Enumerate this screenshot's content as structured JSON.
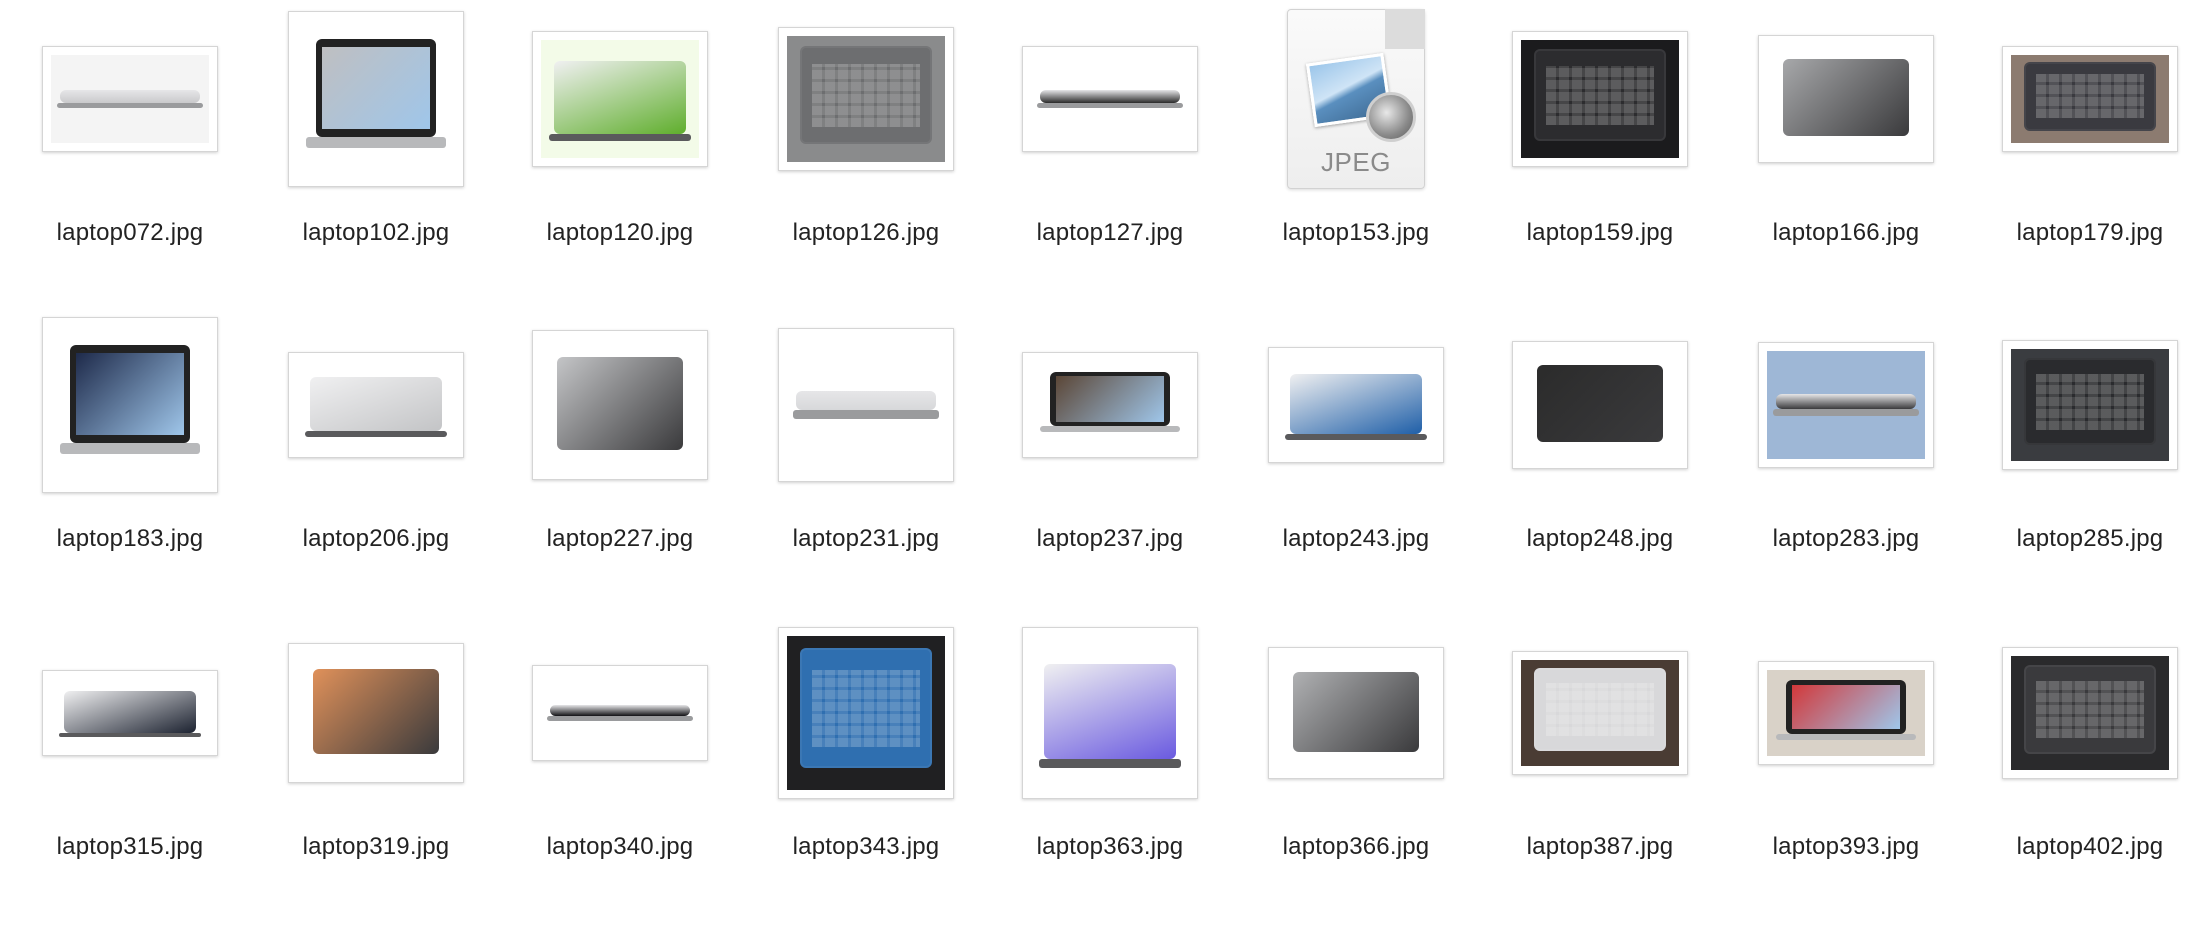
{
  "files": [
    {
      "name": "laptop072.jpg",
      "icon": "photo-thumbnail",
      "bg": "#f4f4f4",
      "accent": "#c9c9cb"
    },
    {
      "name": "laptop102.jpg",
      "icon": "photo-thumbnail",
      "bg": "#ffffff",
      "accent": "#bfbfc1"
    },
    {
      "name": "laptop120.jpg",
      "icon": "photo-thumbnail",
      "bg": "#f3fbe8",
      "accent": "#5fae2c"
    },
    {
      "name": "laptop126.jpg",
      "icon": "photo-thumbnail",
      "bg": "#8a8b8c",
      "accent": "#6d6e70"
    },
    {
      "name": "laptop127.jpg",
      "icon": "photo-thumbnail",
      "bg": "#ffffff",
      "accent": "#2a2a2a"
    },
    {
      "name": "laptop153.jpg",
      "icon": "jpeg-document-icon",
      "label": "JPEG"
    },
    {
      "name": "laptop159.jpg",
      "icon": "photo-thumbnail",
      "bg": "#1b1b1d",
      "accent": "#2c2c2f"
    },
    {
      "name": "laptop166.jpg",
      "icon": "photo-thumbnail",
      "bg": "#ffffff",
      "accent": "#a7a8aa"
    },
    {
      "name": "laptop179.jpg",
      "icon": "photo-thumbnail",
      "bg": "#8c7b70",
      "accent": "#3a3a40"
    },
    {
      "name": "laptop183.jpg",
      "icon": "photo-thumbnail",
      "bg": "#ffffff",
      "accent": "#1e2a4a"
    },
    {
      "name": "laptop206.jpg",
      "icon": "photo-thumbnail",
      "bg": "#ffffff",
      "accent": "#c3c4c6"
    },
    {
      "name": "laptop227.jpg",
      "icon": "photo-thumbnail",
      "bg": "#ffffff",
      "accent": "#c4c5c7"
    },
    {
      "name": "laptop231.jpg",
      "icon": "photo-thumbnail",
      "bg": "#ffffff",
      "accent": "#d7d8da"
    },
    {
      "name": "laptop237.jpg",
      "icon": "photo-thumbnail",
      "bg": "#ffffff",
      "accent": "#5b4636"
    },
    {
      "name": "laptop243.jpg",
      "icon": "photo-thumbnail",
      "bg": "#ffffff",
      "accent": "#1f5fa8"
    },
    {
      "name": "laptop248.jpg",
      "icon": "photo-thumbnail",
      "bg": "#ffffff",
      "accent": "#2b2b2b"
    },
    {
      "name": "laptop283.jpg",
      "icon": "photo-thumbnail",
      "bg": "#9eb7d6",
      "accent": "#3a3a3c"
    },
    {
      "name": "laptop285.jpg",
      "icon": "photo-thumbnail",
      "bg": "#3a3c40",
      "accent": "#2a2b2e"
    },
    {
      "name": "laptop315.jpg",
      "icon": "photo-thumbnail",
      "bg": "#ffffff",
      "accent": "#1c2230"
    },
    {
      "name": "laptop319.jpg",
      "icon": "photo-thumbnail",
      "bg": "#ffffff",
      "accent": "#e0915a"
    },
    {
      "name": "laptop340.jpg",
      "icon": "photo-thumbnail",
      "bg": "#ffffff",
      "accent": "#111114"
    },
    {
      "name": "laptop343.jpg",
      "icon": "photo-thumbnail",
      "bg": "#202022",
      "accent": "#2f6fb0"
    },
    {
      "name": "laptop363.jpg",
      "icon": "photo-thumbnail",
      "bg": "#ffffff",
      "accent": "#6a5ae0"
    },
    {
      "name": "laptop366.jpg",
      "icon": "photo-thumbnail",
      "bg": "#ffffff",
      "accent": "#b0b1b3"
    },
    {
      "name": "laptop387.jpg",
      "icon": "photo-thumbnail",
      "bg": "#4a3c34",
      "accent": "#d8d8da"
    },
    {
      "name": "laptop393.jpg",
      "icon": "photo-thumbnail",
      "bg": "#d9d2c8",
      "accent": "#d2383a"
    },
    {
      "name": "laptop402.jpg",
      "icon": "photo-thumbnail",
      "bg": "#2a2a2c",
      "accent": "#3a3a3d"
    }
  ]
}
